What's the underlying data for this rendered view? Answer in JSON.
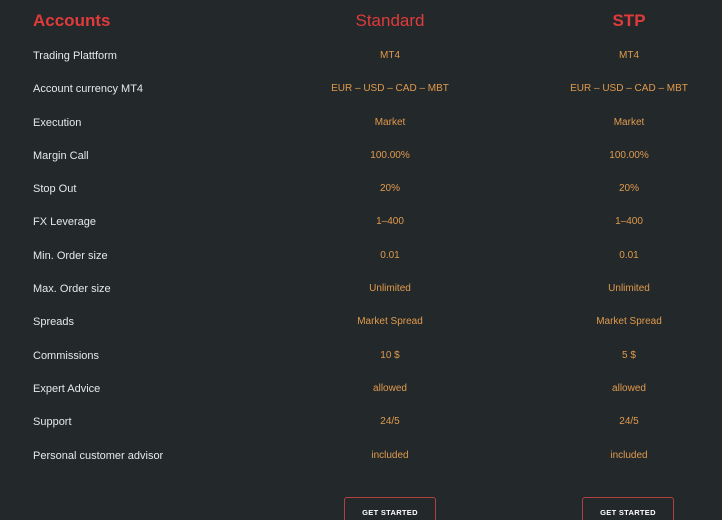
{
  "header": {
    "label": "Accounts",
    "columns": [
      "Standard",
      "STP"
    ]
  },
  "rows": [
    {
      "label": "Trading Plattform",
      "standard": "MT4",
      "stp": "MT4"
    },
    {
      "label": "Account currency MT4",
      "standard": "EUR – USD – CAD – MBT",
      "stp": "EUR – USD – CAD – MBT"
    },
    {
      "label": "Execution",
      "standard": "Market",
      "stp": "Market"
    },
    {
      "label": "Margin Call",
      "standard": "100.00%",
      "stp": "100.00%"
    },
    {
      "label": "Stop Out",
      "standard": "20%",
      "stp": "20%"
    },
    {
      "label": "FX Leverage",
      "standard": "1–400",
      "stp": "1–400"
    },
    {
      "label": "Min. Order size",
      "standard": "0.01",
      "stp": "0.01"
    },
    {
      "label": "Max. Order size",
      "standard": "Unlimited",
      "stp": "Unlimited"
    },
    {
      "label": "Spreads",
      "standard": "Market Spread",
      "stp": "Market Spread"
    },
    {
      "label": "Commissions",
      "standard": "10 $",
      "stp": "5 $"
    },
    {
      "label": "Expert Advice",
      "standard": "allowed",
      "stp": "allowed"
    },
    {
      "label": "Support",
      "standard": "24/5",
      "stp": "24/5"
    },
    {
      "label": "Personal customer advisor",
      "standard": "included",
      "stp": "included"
    }
  ],
  "buttons": {
    "standard_label": "GET STARTED",
    "stp_label": "GET STARTED"
  },
  "colors": {
    "background": "#23282b",
    "accent_red": "#e03b3b",
    "value_orange": "#e09a4c",
    "label_white": "#e6e8e9"
  }
}
